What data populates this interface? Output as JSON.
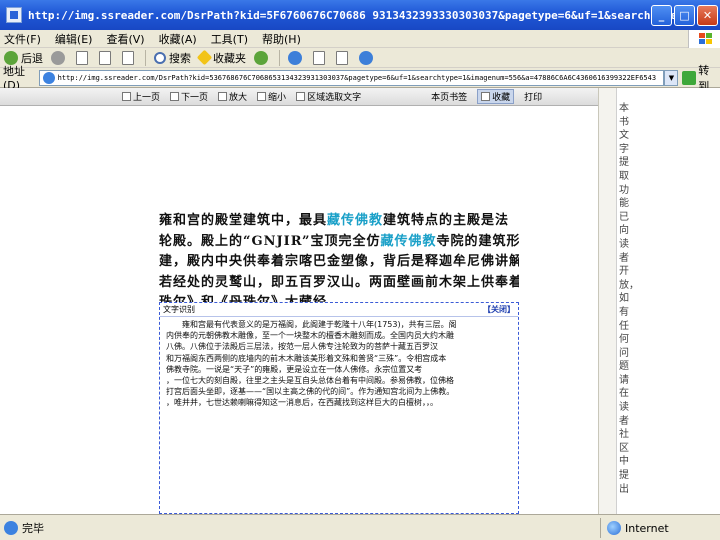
{
  "window": {
    "title": "http://img.ssreader.com/DsrPath?kid=5F6760676C70686 9313432393330303037&pagetype=6&uf=1&searchtype - Microsoft Inter..."
  },
  "menu": [
    "文件(F)",
    "编辑(E)",
    "查看(V)",
    "收藏(A)",
    "工具(T)",
    "帮助(H)"
  ],
  "toolbar": {
    "back": "后退",
    "search": "搜索",
    "favorites": "收藏夹"
  },
  "address": {
    "label": "地址(D)",
    "url": "http://img.ssreader.com/DsrPath?kid=536768676C7068653134323931303037&pagetype=6&uf=1&searchtype=1&imagenum=556&a=47886C6A6C4360616399322EF6543",
    "go": "转到"
  },
  "viewer_toolbar": {
    "prev": "上一页",
    "next": "下一页",
    "zoom_in": "放大",
    "zoom_out": "缩小",
    "ocr": "区域选取文字",
    "bookmark_page": "本页书签",
    "collect": "收藏",
    "print": "打印"
  },
  "page_text": [
    [
      "雍和宫的殿堂建筑中，最具",
      "藏传佛教",
      "建筑特点的主殿是法"
    ],
    [
      "轮殿。殿上的“GNJIR”宝顶完全仿",
      "藏传佛教",
      "寺院的建筑形式而"
    ],
    [
      "建，殿内中央供奉着宗喀巴金塑像，背后是释迦牟尼佛讲解般",
      "",
      ""
    ],
    [
      "若经处的灵鹫山，即五百罗汉山。两面壁画前木架上供奉着《甘",
      "",
      ""
    ],
    [
      "珠尔》和《丹珠尔》大藏经。",
      "",
      ""
    ]
  ],
  "ocr": {
    "title": "文字识别",
    "close": "【关闭】",
    "lines": [
      "　　雍和宫最有代表意义的是万福阁，此阁建于乾隆十八年(1753)，共有三层。阁",
      "内供奉的元朝佛教木雕像，至一个一块整木的檀香木雕刻而成。全国内员大约木雕",
      "八佛。八佛位于法殿后三层法，按范一层人佛专注轮致为的菩萨十藏五百罗汉",
      "和万福阁东西两侧的底墙内的前木木雕该美形着文殊和普贤“三殊”。令相宫成本",
      "佛教寺院。一说是“天子”的雍殿，更是设立在一体人佛修。永宗位置又考",
      "，一位七大的刻自殿，往里之主头是互自头总体台着有中间殿。参易佛教，位佛格",
      "打宫后面头坐即，逐基——“国以主高之佛的代的间”。作为通知宫北间为上佛教。",
      "，唯并并，七世达赖喇嘛得知这一消息后，在西藏找到这样巨大的白檀树，，。"
    ]
  },
  "side_text": "本书文字提取功能已向读者开放，如有任何问题请在读者社区中提出",
  "status": {
    "left": "完毕",
    "zone": "Internet"
  }
}
